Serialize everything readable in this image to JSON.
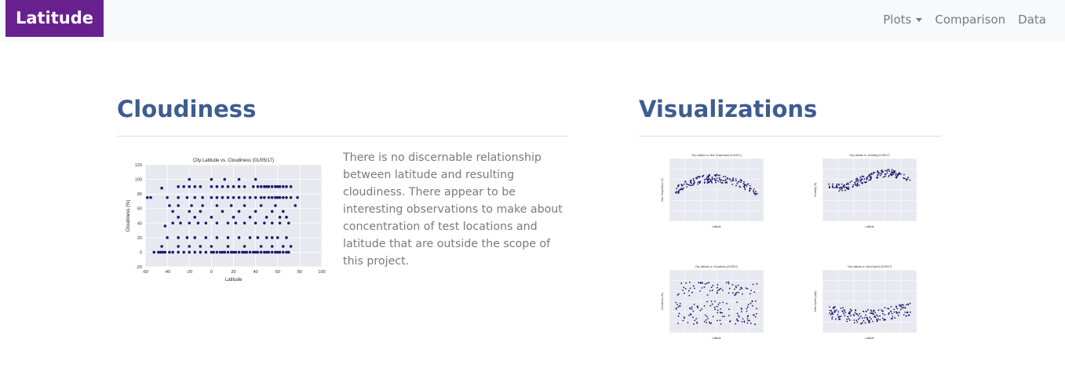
{
  "nav": {
    "brand": "Latitude",
    "items": [
      {
        "label": "Plots",
        "dropdown": true
      },
      {
        "label": "Comparison"
      },
      {
        "label": "Data"
      }
    ]
  },
  "colors": {
    "brand_bg": "#68208f",
    "heading": "#3e5c90",
    "plot_bg": "#e8e8f0",
    "point": "#191970"
  },
  "main": {
    "title": "Cloudiness",
    "description": "There is no discernable relationship between latitude and resulting cloudiness. There appear to be interesting observations to make about concentration of test locations and latitude that are outside the scope of this project."
  },
  "side": {
    "title": "Visualizations",
    "thumbnails": [
      {
        "title": "City Latitude vs. Max Temperature (01/05/17)",
        "xlabel": "Latitude",
        "ylabel": "Max Temperature (F)"
      },
      {
        "title": "City Latitude vs. Humidity (01/05/17)",
        "xlabel": "Latitude",
        "ylabel": "Humidity (%)"
      },
      {
        "title": "City Latitude vs. Cloudiness (01/05/17)",
        "xlabel": "Latitude",
        "ylabel": "Cloudiness (%)"
      },
      {
        "title": "City Latitude vs. Wind Speed (01/05/17)",
        "xlabel": "Latitude",
        "ylabel": "Wind Speed (mph)"
      }
    ]
  },
  "chart_data": {
    "type": "scatter",
    "title": "City Latitude vs. Cloudiness (01/05/17)",
    "xlabel": "Latitude",
    "ylabel": "Cloudiness (%)",
    "xlim": [
      -60,
      100
    ],
    "ylim": [
      -20,
      120
    ],
    "xticks": [
      -60,
      -40,
      -20,
      0,
      20,
      40,
      60,
      80,
      100
    ],
    "yticks": [
      -20,
      0,
      20,
      40,
      60,
      80,
      100,
      120
    ],
    "grid": true,
    "points": [
      [
        -52,
        0
      ],
      [
        -48,
        0
      ],
      [
        -46,
        0
      ],
      [
        -44,
        0
      ],
      [
        -42,
        0
      ],
      [
        -38,
        0
      ],
      [
        -35,
        0
      ],
      [
        -30,
        0
      ],
      [
        -25,
        0
      ],
      [
        -20,
        0
      ],
      [
        -15,
        0
      ],
      [
        -10,
        0
      ],
      [
        -5,
        0
      ],
      [
        0,
        0
      ],
      [
        2,
        0
      ],
      [
        5,
        0
      ],
      [
        8,
        0
      ],
      [
        10,
        0
      ],
      [
        12,
        0
      ],
      [
        15,
        0
      ],
      [
        18,
        0
      ],
      [
        20,
        0
      ],
      [
        22,
        0
      ],
      [
        25,
        0
      ],
      [
        28,
        0
      ],
      [
        30,
        0
      ],
      [
        32,
        0
      ],
      [
        35,
        0
      ],
      [
        38,
        0
      ],
      [
        40,
        0
      ],
      [
        42,
        0
      ],
      [
        45,
        0
      ],
      [
        48,
        0
      ],
      [
        50,
        0
      ],
      [
        52,
        0
      ],
      [
        55,
        0
      ],
      [
        58,
        0
      ],
      [
        60,
        0
      ],
      [
        62,
        0
      ],
      [
        65,
        0
      ],
      [
        68,
        0
      ],
      [
        70,
        0
      ],
      [
        -45,
        8
      ],
      [
        -30,
        8
      ],
      [
        -20,
        8
      ],
      [
        -10,
        8
      ],
      [
        0,
        8
      ],
      [
        15,
        8
      ],
      [
        30,
        8
      ],
      [
        45,
        8
      ],
      [
        55,
        8
      ],
      [
        65,
        8
      ],
      [
        72,
        8
      ],
      [
        -40,
        20
      ],
      [
        -30,
        20
      ],
      [
        -22,
        20
      ],
      [
        -15,
        20
      ],
      [
        -5,
        20
      ],
      [
        5,
        20
      ],
      [
        15,
        20
      ],
      [
        25,
        20
      ],
      [
        35,
        20
      ],
      [
        42,
        20
      ],
      [
        50,
        20
      ],
      [
        55,
        20
      ],
      [
        60,
        20
      ],
      [
        68,
        20
      ],
      [
        -42,
        36
      ],
      [
        -35,
        40
      ],
      [
        -28,
        40
      ],
      [
        -20,
        40
      ],
      [
        -12,
        40
      ],
      [
        -5,
        40
      ],
      [
        5,
        40
      ],
      [
        15,
        40
      ],
      [
        22,
        40
      ],
      [
        30,
        40
      ],
      [
        40,
        40
      ],
      [
        48,
        40
      ],
      [
        55,
        40
      ],
      [
        62,
        40
      ],
      [
        70,
        40
      ],
      [
        -30,
        48
      ],
      [
        -15,
        48
      ],
      [
        0,
        48
      ],
      [
        20,
        48
      ],
      [
        35,
        48
      ],
      [
        50,
        48
      ],
      [
        62,
        48
      ],
      [
        68,
        48
      ],
      [
        -35,
        56
      ],
      [
        -20,
        56
      ],
      [
        -10,
        56
      ],
      [
        10,
        56
      ],
      [
        25,
        56
      ],
      [
        40,
        56
      ],
      [
        55,
        56
      ],
      [
        65,
        56
      ],
      [
        -38,
        64
      ],
      [
        -30,
        64
      ],
      [
        -18,
        64
      ],
      [
        -8,
        64
      ],
      [
        5,
        64
      ],
      [
        18,
        64
      ],
      [
        30,
        64
      ],
      [
        45,
        64
      ],
      [
        58,
        64
      ],
      [
        76,
        64
      ],
      [
        -58,
        75
      ],
      [
        -55,
        75
      ],
      [
        -40,
        75
      ],
      [
        -30,
        75
      ],
      [
        -22,
        75
      ],
      [
        -15,
        75
      ],
      [
        -8,
        75
      ],
      [
        0,
        75
      ],
      [
        5,
        75
      ],
      [
        10,
        75
      ],
      [
        15,
        75
      ],
      [
        20,
        75
      ],
      [
        25,
        75
      ],
      [
        30,
        75
      ],
      [
        35,
        75
      ],
      [
        40,
        75
      ],
      [
        45,
        75
      ],
      [
        48,
        75
      ],
      [
        52,
        75
      ],
      [
        55,
        75
      ],
      [
        58,
        75
      ],
      [
        60,
        75
      ],
      [
        62,
        75
      ],
      [
        65,
        75
      ],
      [
        68,
        75
      ],
      [
        72,
        75
      ],
      [
        78,
        75
      ],
      [
        -45,
        88
      ],
      [
        -30,
        90
      ],
      [
        -25,
        90
      ],
      [
        -20,
        90
      ],
      [
        -15,
        90
      ],
      [
        -10,
        90
      ],
      [
        0,
        90
      ],
      [
        5,
        90
      ],
      [
        10,
        90
      ],
      [
        15,
        90
      ],
      [
        20,
        90
      ],
      [
        25,
        90
      ],
      [
        30,
        90
      ],
      [
        38,
        90
      ],
      [
        42,
        90
      ],
      [
        45,
        90
      ],
      [
        48,
        90
      ],
      [
        50,
        90
      ],
      [
        52,
        90
      ],
      [
        55,
        90
      ],
      [
        58,
        90
      ],
      [
        60,
        90
      ],
      [
        62,
        90
      ],
      [
        65,
        90
      ],
      [
        68,
        90
      ],
      [
        72,
        90
      ],
      [
        -20,
        100
      ],
      [
        0,
        100
      ],
      [
        12,
        100
      ],
      [
        25,
        100
      ],
      [
        40,
        100
      ]
    ]
  }
}
